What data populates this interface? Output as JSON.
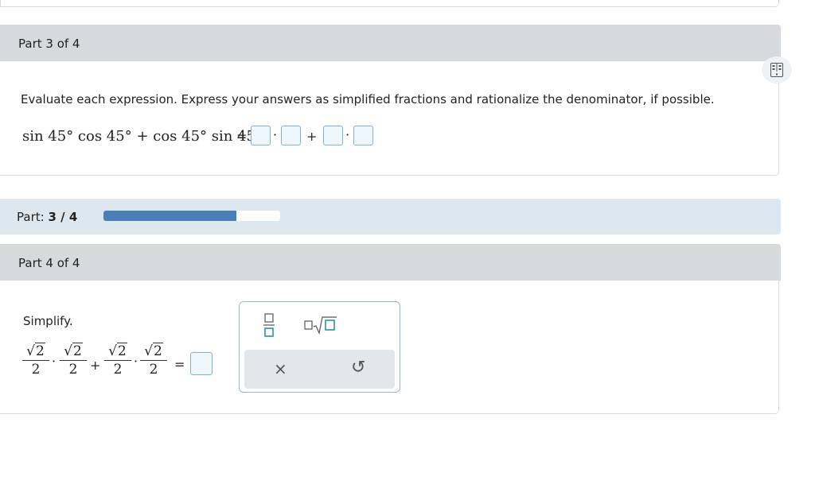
{
  "part3": {
    "header": "Part 3 of 4",
    "instruction": "Evaluate each expression. Express your answers as simplified fractions and rationalize the denominator, if possible.",
    "expression": "sin 45° cos 45° + cos 45° sin 45°",
    "equals": "=",
    "dot": "·",
    "plus": "+"
  },
  "progress": {
    "label": "Part:",
    "value_text": "3 / 4",
    "fraction": 0.75
  },
  "part4": {
    "header": "Part 4 of 4",
    "prompt": "Simplify.",
    "numerator": "√2",
    "sqrt_symbol": "√",
    "radicand": "2",
    "denominator": "2",
    "dot": "·",
    "plus": "+",
    "equals": "="
  },
  "palette": {
    "fraction_icon": "fraction-icon",
    "sqrt_icon": "sqrt-icon",
    "clear_symbol": "×",
    "undo_symbol": "↺"
  },
  "side_icon": "calculator-icon"
}
